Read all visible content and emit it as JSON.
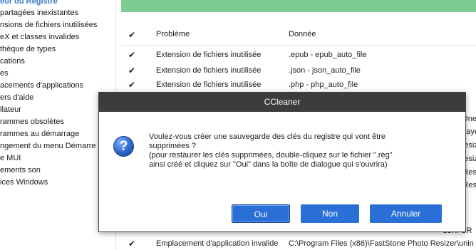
{
  "sidebar": {
    "header": "eur du Registre",
    "items": [
      "partagées inexistantes",
      "nsions de fichiers inutilisées",
      "eX et classes invalides",
      "thèque de types",
      "cations",
      "es",
      "acements d'applications",
      "ers d'aide",
      "llateur",
      "rammes obsolètes",
      "rammes au démarrage",
      "ngement du menu Démarre",
      "e MUI",
      "ements son",
      "ices Windows"
    ]
  },
  "table": {
    "header": {
      "problem": "Problème",
      "data": "Donnée"
    },
    "rows": [
      {
        "problem": "Extension de fichiers inutilisée",
        "data": ".epub - epub_auto_file"
      },
      {
        "problem": "Extension de fichiers inutilisée",
        "data": ".json - json_auto_file"
      },
      {
        "problem": "Extension de fichiers inutilisée",
        "data": ".php - php_auto_file"
      }
    ],
    "bottom_row": {
      "problem": "Emplacement d'application invalide",
      "data": "C:\\Program Files (x86)\\FastStone Photo Resizer\\unin"
    },
    "right_fragments": [
      "fice.One",
      "ashplaye",
      "ge Resiz",
      "ge Resiz",
      "age Res",
      "age Res",
      "zer\\FSR"
    ]
  },
  "dialog": {
    "title": "CCleaner",
    "message_line1": "Voulez-vous créer une sauvegarde des clés du registre qui vont être",
    "message_line2": "supprimées ?",
    "message_line3": "(pour restaurer les clés supprimées, double-cliquez sur le fichier \".reg\"",
    "message_line4": "ainsi créé et cliquez sur \"Oui\" dans la boîte de dialogue qui s'ouvrira)",
    "buttons": {
      "yes": "Oui",
      "no": "Non",
      "cancel": "Annuler"
    }
  },
  "check_glyph": "✔",
  "icon_glyph": "?",
  "colors": {
    "progress": "#7dcc92",
    "dialog_title_bg": "#3c3c3c",
    "button_bg": "#2a6fd6"
  }
}
